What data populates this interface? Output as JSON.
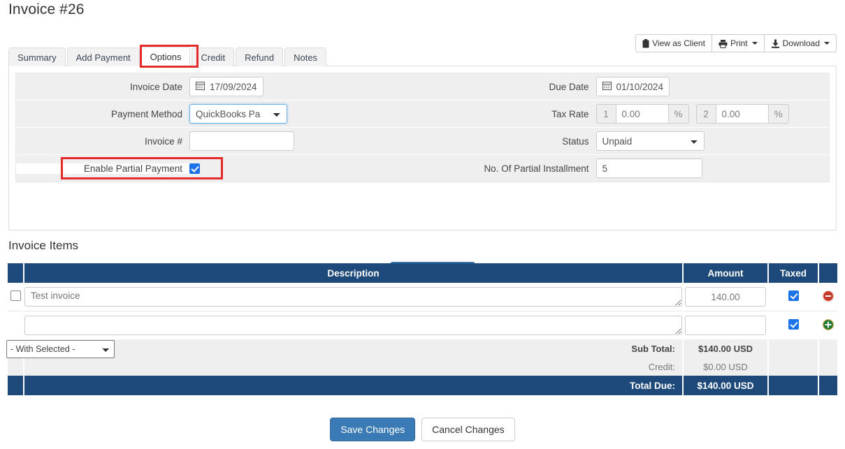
{
  "header": {
    "title": "Invoice #26"
  },
  "toolbar": {
    "view_as_client": "View as Client",
    "print": "Print",
    "download": "Download",
    "icons": {
      "view_as_client": "clipboard-icon",
      "print": "printer-icon",
      "download": "download-icon"
    }
  },
  "tabs": [
    {
      "label": "Summary",
      "active": false
    },
    {
      "label": "Add Payment",
      "active": false
    },
    {
      "label": "Options",
      "active": true
    },
    {
      "label": "Credit",
      "active": false
    },
    {
      "label": "Refund",
      "active": false
    },
    {
      "label": "Notes",
      "active": false
    }
  ],
  "form": {
    "left": {
      "invoice_date_label": "Invoice Date",
      "invoice_date_value": "17/09/2024",
      "payment_method_label": "Payment Method",
      "payment_method_value": "QuickBooks Pa",
      "payment_method_options": [
        "QuickBooks Pa"
      ],
      "invoice_number_label": "Invoice #",
      "invoice_number_value": "",
      "enable_partial_payment_label": "Enable Partial Payment",
      "enable_partial_payment_checked": true
    },
    "right": {
      "due_date_label": "Due Date",
      "due_date_value": "01/10/2024",
      "tax_rate_label": "Tax Rate",
      "tax1_prefix": "1",
      "tax1_value": "0.00",
      "tax1_suffix": "%",
      "tax2_prefix": "2",
      "tax2_value": "0.00",
      "tax2_suffix": "%",
      "status_label": "Status",
      "status_value": "Unpaid",
      "status_options": [
        "Unpaid"
      ],
      "installments_label": "No. Of Partial Installment",
      "installments_value": "5"
    },
    "save_changes_label": "Save Changes"
  },
  "items": {
    "section_title": "Invoice Items",
    "columns": {
      "description": "Description",
      "amount": "Amount",
      "taxed": "Taxed"
    },
    "rows": [
      {
        "selected": false,
        "description": "Test invoice",
        "amount": "140.00",
        "taxed": true,
        "action": "remove-icon"
      },
      {
        "selected": false,
        "description": "",
        "amount": "",
        "taxed": true,
        "action": "add-icon"
      }
    ],
    "with_selected_value": "- With Selected -",
    "with_selected_options": [
      "- With Selected -"
    ],
    "totals": [
      {
        "label": "Sub Total:",
        "value": "$140.00 USD",
        "emphasis": true
      },
      {
        "label": "Credit:",
        "value": "$0.00 USD",
        "emphasis": false
      }
    ],
    "grand_total": {
      "label": "Total Due:",
      "value": "$140.00 USD"
    }
  },
  "footer": {
    "save_changes_label": "Save Changes",
    "cancel_changes_label": "Cancel Changes"
  },
  "colors": {
    "table_header": "#1e4a7b",
    "primary_button": "#3b7bb5",
    "highlight": "#e52a2a",
    "checkbox_checked": "#1a73e8"
  }
}
